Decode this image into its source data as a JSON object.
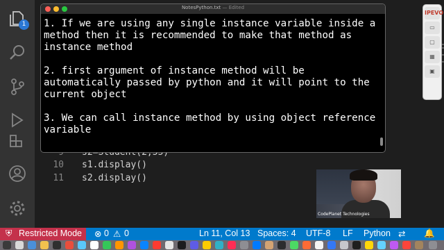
{
  "activity_bar": {
    "explorer_badge": "1",
    "icons": [
      "files-icon",
      "search-icon",
      "source-control-icon",
      "run-debug-icon",
      "extensions-icon",
      "account-icon",
      "settings-gear-icon"
    ]
  },
  "editor": {
    "lines": [
      {
        "number": "9",
        "code": "s2=Student(2,55)"
      },
      {
        "number": "10",
        "code": "s1.display()"
      },
      {
        "number": "11",
        "code": "s2.display()"
      }
    ]
  },
  "notes_window": {
    "title": "NotesPython.txt",
    "edited": "— Edited",
    "paragraphs": [
      "1. If we are using any single instance variable inside a method then it is recommended to make that method as instance method",
      "2. first argument of instance method will be automatically passed by python and it will point to the current object",
      "3. We can call instance method by using object reference variable"
    ]
  },
  "side_toolbar": {
    "label": "IPEVO"
  },
  "webcam": {
    "overlay_text": "CodePlanet Technologies"
  },
  "status_bar": {
    "restricted_mode": "Restricted Mode",
    "errors": "0",
    "warnings": "0",
    "cursor_position": "Ln 11, Col 13",
    "indentation": "Spaces: 4",
    "encoding": "UTF-8",
    "line_ending": "LF",
    "language": "Python"
  },
  "colors": {
    "status_bar": "#007acc",
    "restricted_bg": "#c4314b",
    "activity_bar": "#333333",
    "editor_bg": "#1e1e1e"
  }
}
